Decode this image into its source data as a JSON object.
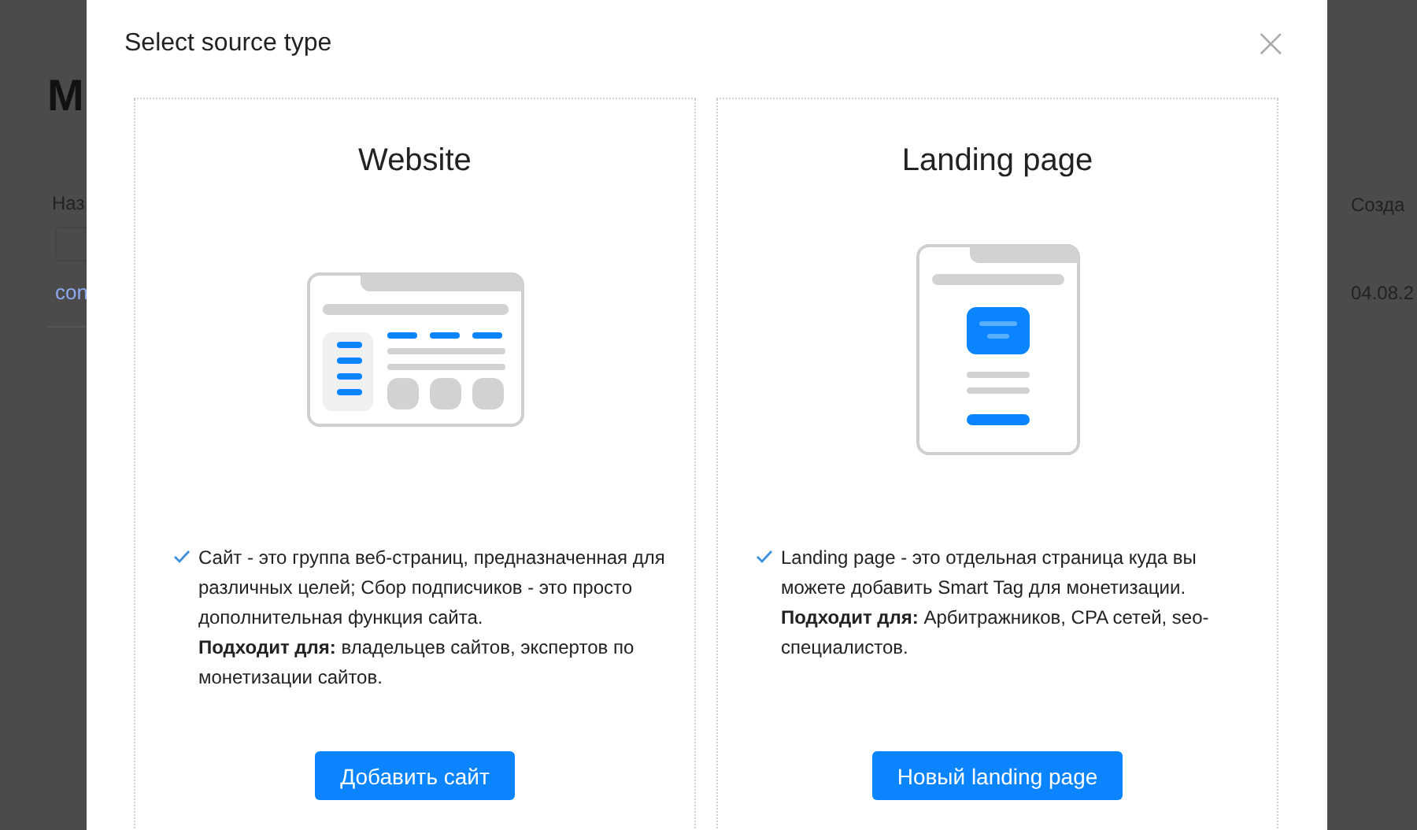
{
  "background_page": {
    "heading": "М",
    "field_label": "Наз",
    "link": "con",
    "column_header": "Созда",
    "date": "04.08.2"
  },
  "modal": {
    "title": "Select source type",
    "close": "×",
    "cards": [
      {
        "kind": "website",
        "title": "Website",
        "description": "Сайт - это группа веб-страниц, предназначенная для различных целей; Сбор подписчиков - это просто дополнительная функция сайта.",
        "audience": "**Подходит для:** владельцев сайтов, экспертов по монетизации сайтов.",
        "button": "Добавить сайт"
      },
      {
        "kind": "landing",
        "title": "Landing page",
        "description": "Landing page - это отдельная страница куда вы можете добавить Smart Tag для монетизации.",
        "audience": "**Подходит для:** Арбитражников, CPA сетей, seo-специалистов.",
        "button": "Новый landing page"
      }
    ]
  }
}
